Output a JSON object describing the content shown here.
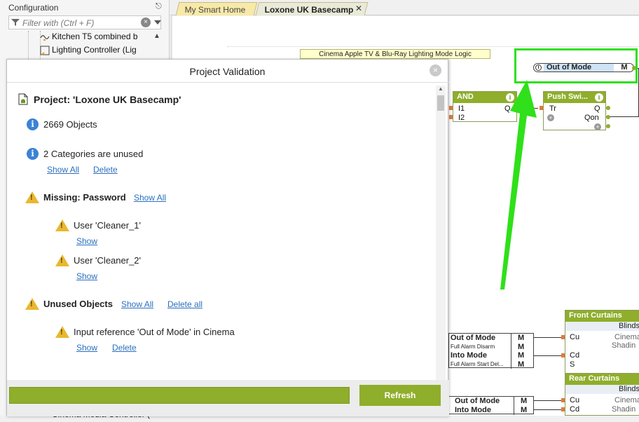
{
  "left_panel": {
    "title": "Configuration",
    "filter_placeholder": "Filter with (Ctrl + F)",
    "tree_items": [
      {
        "label": "Kitchen T5 combined b"
      },
      {
        "label": "Lighting Controller (Lig"
      },
      {
        "label": "Cinema Media Controller ("
      }
    ]
  },
  "tabs": [
    {
      "label": "My Smart Home",
      "active": false
    },
    {
      "label": "Loxone UK Basecamp",
      "active": true
    }
  ],
  "canvas": {
    "comment": "Cinema Apple TV & Blu-Ray Lighting Mode Logic",
    "refs": {
      "out_of_mode": "Out of Mode",
      "into_mode": "Into Mode",
      "m": "M",
      "full_alarm_disarm": "Full Alarm Disarm",
      "full_alarm_start": "Full Alarm Start Del..."
    },
    "and_block": {
      "title": "AND",
      "inputs": [
        "I1",
        "I2"
      ],
      "output": "Q"
    },
    "push_block": {
      "title": "Push Swi...",
      "input": "Tr",
      "outputs": [
        "Q",
        "Qon"
      ]
    },
    "front_curtains": {
      "title": "Front Curtains",
      "sub": "Blinds",
      "inputs": [
        "Cu",
        "Cd",
        "S"
      ],
      "text1": "Cinema",
      "text2": "Shadin"
    },
    "rear_curtains": {
      "title": "Rear Curtains",
      "sub": "Blinds",
      "inputs": [
        "Cu",
        "Cd"
      ],
      "text1": "Cinema",
      "text2": "Shadin"
    }
  },
  "dialog": {
    "title": "Project Validation",
    "project": "Project: 'Loxone UK Basecamp'",
    "objects_count": "2669 Objects",
    "categories_unused": "2 Categories are unused",
    "show_all": "Show All",
    "delete": "Delete",
    "missing_password": "Missing: Password",
    "users": [
      "User 'Cleaner_1'",
      "User 'Cleaner_2'"
    ],
    "show": "Show",
    "unused_objects": "Unused Objects",
    "delete_all": "Delete all",
    "input_reference": "Input reference 'Out of Mode' in Cinema",
    "refresh": "Refresh",
    "progress": 1.0
  },
  "colors": {
    "accent": "#8fae2b",
    "highlight": "#2fe01a",
    "link": "#2a6fc0"
  }
}
